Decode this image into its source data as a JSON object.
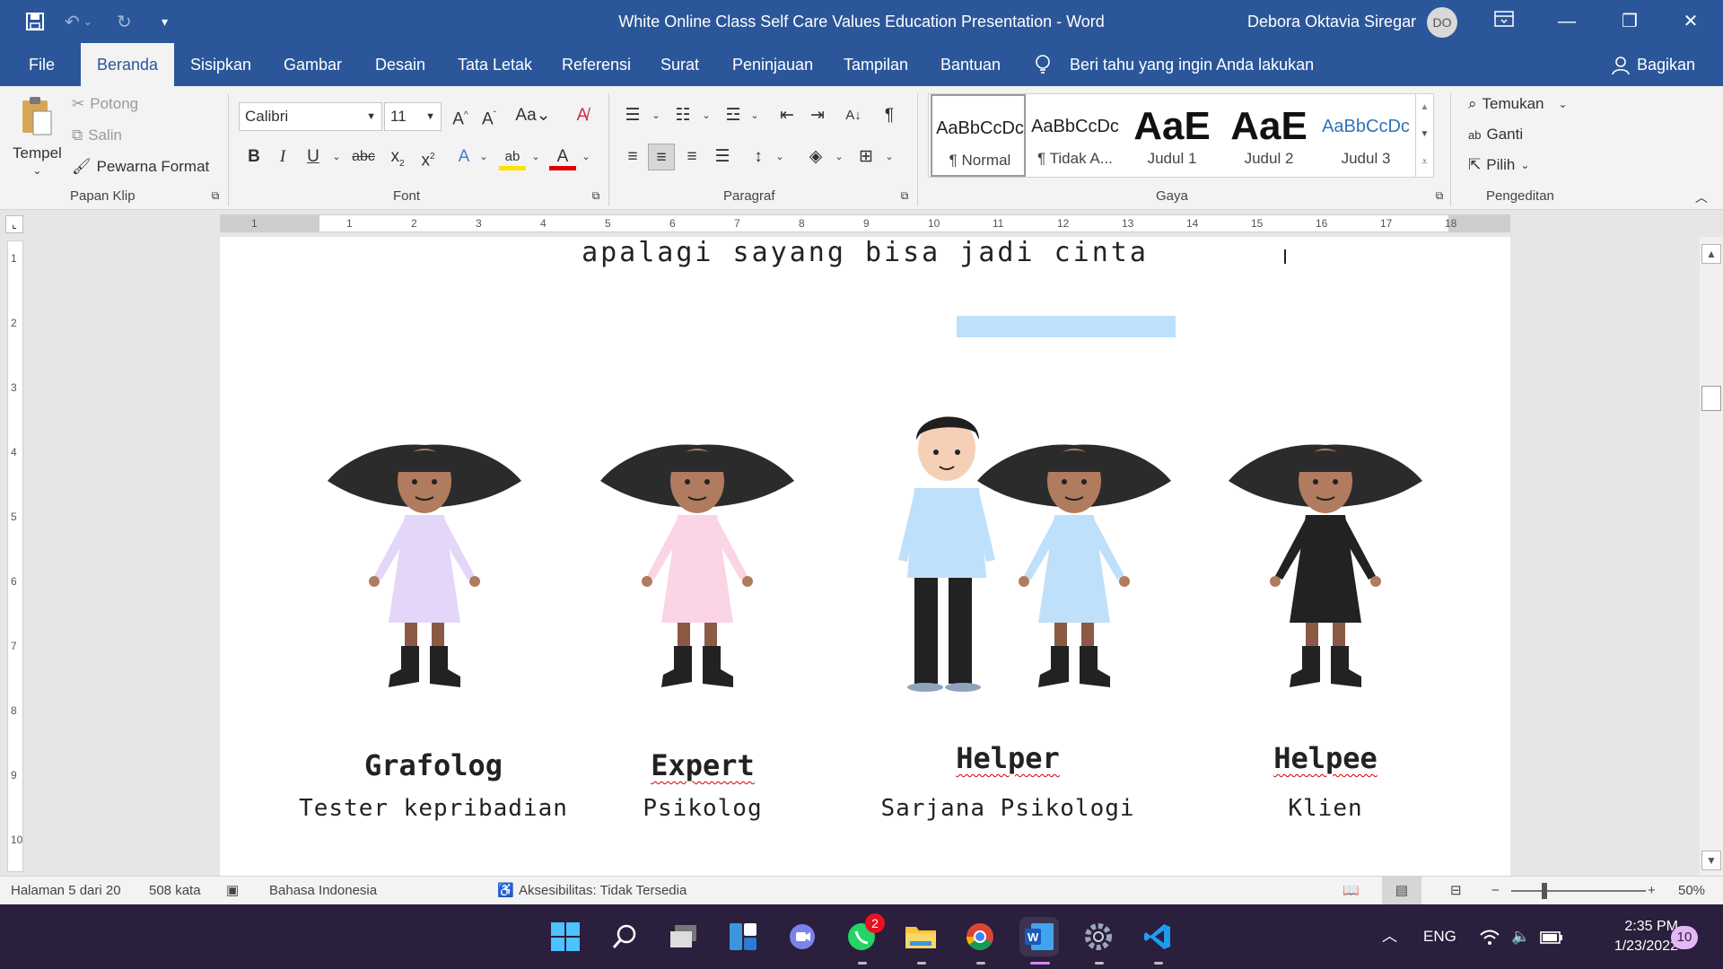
{
  "titlebar": {
    "title": "White Online Class Self Care Values Education Presentation  -  Word",
    "user": "Debora Oktavia Siregar",
    "avatar_initials": "DO"
  },
  "tabs": {
    "file": "File",
    "home": "Beranda",
    "insert": "Sisipkan",
    "draw": "Gambar",
    "design": "Desain",
    "layout": "Tata Letak",
    "references": "Referensi",
    "mailings": "Surat",
    "review": "Peninjauan",
    "view": "Tampilan",
    "help": "Bantuan",
    "tell_me": "Beri tahu yang ingin Anda lakukan",
    "share": "Bagikan"
  },
  "ribbon": {
    "clipboard": {
      "paste": "Tempel",
      "cut": "Potong",
      "copy": "Salin",
      "format_painter": "Pewarna Format",
      "label": "Papan Klip"
    },
    "font": {
      "name": "Calibri",
      "size": "11",
      "case": "Aa",
      "label": "Font"
    },
    "paragraph": {
      "label": "Paragraf"
    },
    "styles": {
      "label": "Gaya",
      "items": [
        {
          "preview": "AaBbCcDc",
          "name": "¶ Normal"
        },
        {
          "preview": "AaBbCcDc",
          "name": "¶ Tidak A..."
        },
        {
          "preview": "AaE",
          "name": "Judul 1"
        },
        {
          "preview": "AaE",
          "name": "Judul 2"
        },
        {
          "preview": "AaBbCcDc",
          "name": "Judul 3"
        }
      ]
    },
    "editing": {
      "find": "Temukan",
      "replace": "Ganti",
      "select": "Pilih",
      "label": "Pengeditan"
    }
  },
  "ruler": {
    "h_numbers": [
      "1",
      "1",
      "2",
      "3",
      "4",
      "5",
      "6",
      "7",
      "8",
      "9",
      "10",
      "11",
      "12",
      "13",
      "14",
      "15",
      "16",
      "17",
      "18"
    ],
    "v_numbers": [
      "1",
      "2",
      "3",
      "4",
      "5",
      "6",
      "7",
      "8",
      "9",
      "10"
    ]
  },
  "document": {
    "top_line": "apalagi sayang bisa jadi cinta",
    "roles": [
      {
        "title": "Grafolog",
        "desc": "Tester kepribadian"
      },
      {
        "title": "Expert",
        "desc": "Psikolog"
      },
      {
        "title": "Helper",
        "desc": "Sarjana Psikologi"
      },
      {
        "title": "Helpee",
        "desc": "Klien"
      }
    ],
    "dress_colors": [
      "#e3d6f9",
      "#fbd5e6",
      "#bfe0fb",
      "#222222"
    ]
  },
  "status": {
    "page": "Halaman 5 dari 20",
    "words": "508 kata",
    "language": "Bahasa Indonesia",
    "accessibility": "Aksesibilitas: Tidak Tersedia",
    "zoom": "50%"
  },
  "taskbar": {
    "whatsapp_badge": "2",
    "lang": "ENG",
    "time": "2:35 PM",
    "date": "1/23/2022",
    "notifications": "10"
  }
}
